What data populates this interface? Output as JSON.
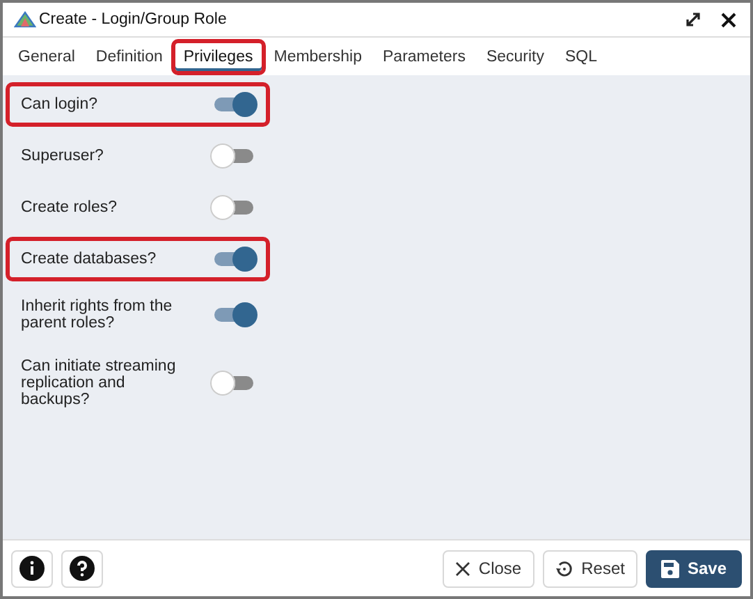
{
  "window": {
    "title": "Create - Login/Group Role"
  },
  "tabs": [
    {
      "label": "General",
      "selected": false,
      "highlighted": false
    },
    {
      "label": "Definition",
      "selected": false,
      "highlighted": false
    },
    {
      "label": "Privileges",
      "selected": true,
      "highlighted": true
    },
    {
      "label": "Membership",
      "selected": false,
      "highlighted": false
    },
    {
      "label": "Parameters",
      "selected": false,
      "highlighted": false
    },
    {
      "label": "Security",
      "selected": false,
      "highlighted": false
    },
    {
      "label": "SQL",
      "selected": false,
      "highlighted": false
    }
  ],
  "privileges": [
    {
      "label": "Can login?",
      "on": true,
      "highlighted": true
    },
    {
      "label": "Superuser?",
      "on": false,
      "highlighted": false
    },
    {
      "label": "Create roles?",
      "on": false,
      "highlighted": false
    },
    {
      "label": "Create databases?",
      "on": true,
      "highlighted": true
    },
    {
      "label": "Inherit rights from the parent roles?",
      "on": true,
      "highlighted": false
    },
    {
      "label": "Can initiate streaming replication and backups?",
      "on": false,
      "highlighted": false
    }
  ],
  "footer": {
    "buttons": [
      {
        "kind": "close",
        "label": "Close"
      },
      {
        "kind": "reset",
        "label": "Reset"
      },
      {
        "kind": "save",
        "label": "Save"
      }
    ]
  }
}
